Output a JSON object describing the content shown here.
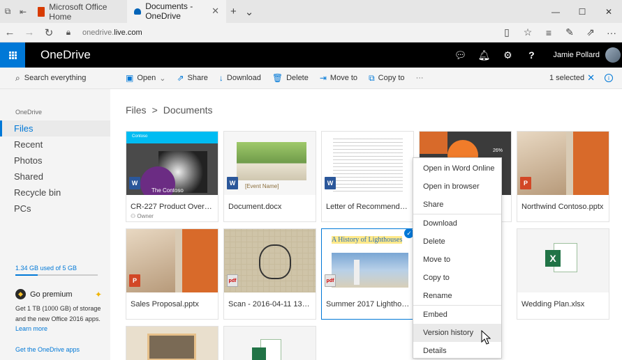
{
  "browser": {
    "tabs": [
      {
        "label": "Microsoft Office Home",
        "active": false
      },
      {
        "label": "Documents - OneDrive",
        "active": true
      }
    ],
    "url_prefix": "onedrive.",
    "url_domain": "live.com"
  },
  "header": {
    "app_name": "OneDrive",
    "user_name": "Jamie Pollard",
    "accent": "#0078d7"
  },
  "sidebar": {
    "search_placeholder": "Search everything",
    "section_label": "OneDrive",
    "items": [
      {
        "label": "Files",
        "selected": true
      },
      {
        "label": "Recent"
      },
      {
        "label": "Photos"
      },
      {
        "label": "Shared"
      },
      {
        "label": "Recycle bin"
      },
      {
        "label": "PCs"
      }
    ],
    "storage_text": "1.34 GB used of 5 GB",
    "storage_fraction": 0.27,
    "premium_title": "Go premium",
    "premium_desc": "Get 1 TB (1000 GB) of storage and the new Office 2016 apps.",
    "premium_link": "Learn more",
    "get_apps": "Get the OneDrive apps"
  },
  "commandbar": {
    "open": "Open",
    "share": "Share",
    "download": "Download",
    "delete": "Delete",
    "move_to": "Move to",
    "copy_to": "Copy to",
    "more": "···",
    "selected_text": "1 selected"
  },
  "breadcrumb": {
    "root": "Files",
    "sep": ">",
    "current": "Documents"
  },
  "files": [
    {
      "name": "CR-227 Product Overvi...",
      "owner": "Owner",
      "type": "word"
    },
    {
      "name": "Document.docx",
      "type": "word"
    },
    {
      "name": "Letter of Recommendat...",
      "type": "word"
    },
    {
      "name": "",
      "type": "ppt"
    },
    {
      "name": "Northwind Contoso.pptx",
      "type": "ppt"
    },
    {
      "name": "Sales Proposal.pptx",
      "type": "ppt"
    },
    {
      "name": "Scan - 2016-04-11 13_5...",
      "type": "pdf"
    },
    {
      "name": "Summer 2017 Lighthou...",
      "type": "pdf",
      "selected": true
    },
    {
      "name": "",
      "type": "excel"
    },
    {
      "name": "Wedding Plan.xlsx",
      "type": "excel"
    }
  ],
  "thumb_text": {
    "contoso": "Contoso",
    "the_contoso": "The Contoso",
    "event_name": "[Event Name]",
    "lighthouses": "A History of Lighthouses",
    "pct": "26%"
  },
  "context_menu": [
    "Open in Word Online",
    "Open in browser",
    "Share",
    "Download",
    "Delete",
    "Move to",
    "Copy to",
    "Rename",
    "Embed",
    "Version history",
    "Details"
  ]
}
